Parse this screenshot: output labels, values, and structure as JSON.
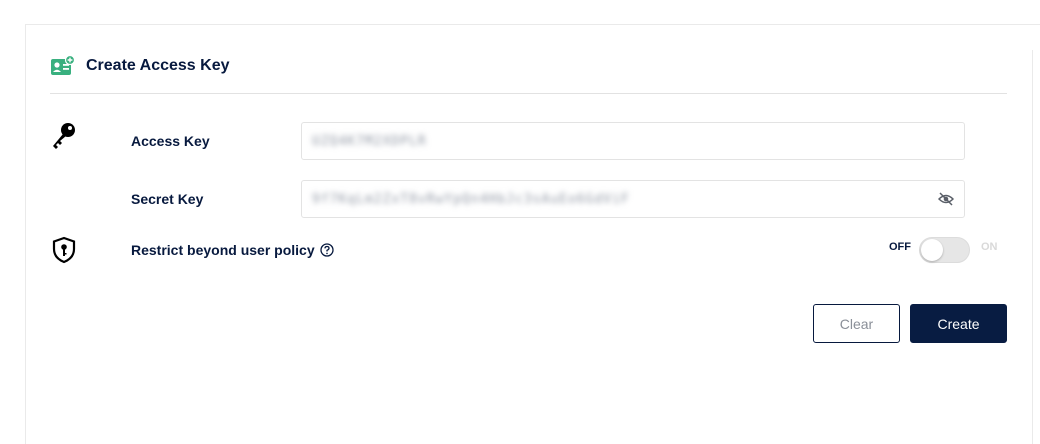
{
  "header": {
    "title": "Create Access Key",
    "icon": "access-key-card-icon",
    "icon_color": "#39b07f"
  },
  "form": {
    "access_key": {
      "label": "Access Key",
      "value": "UZQ4K7M2XDPLR",
      "icon": "key-icon"
    },
    "secret_key": {
      "label": "Secret Key",
      "value": "9f7KqLm2ZxT8vRwYpQn4HbJc3sAuEo6GdViF",
      "toggle_icon": "eye-off-icon"
    },
    "restrict": {
      "label": "Restrict beyond user policy",
      "help_icon": "help-circle-icon",
      "icon": "shield-key-icon"
    },
    "toggle": {
      "off_label": "OFF",
      "on_label": "ON",
      "state": "off"
    }
  },
  "buttons": {
    "clear_label": "Clear",
    "create_label": "Create"
  },
  "colors": {
    "primary": "#081c42",
    "text": "#07193e",
    "accent_green": "#39b07f"
  }
}
